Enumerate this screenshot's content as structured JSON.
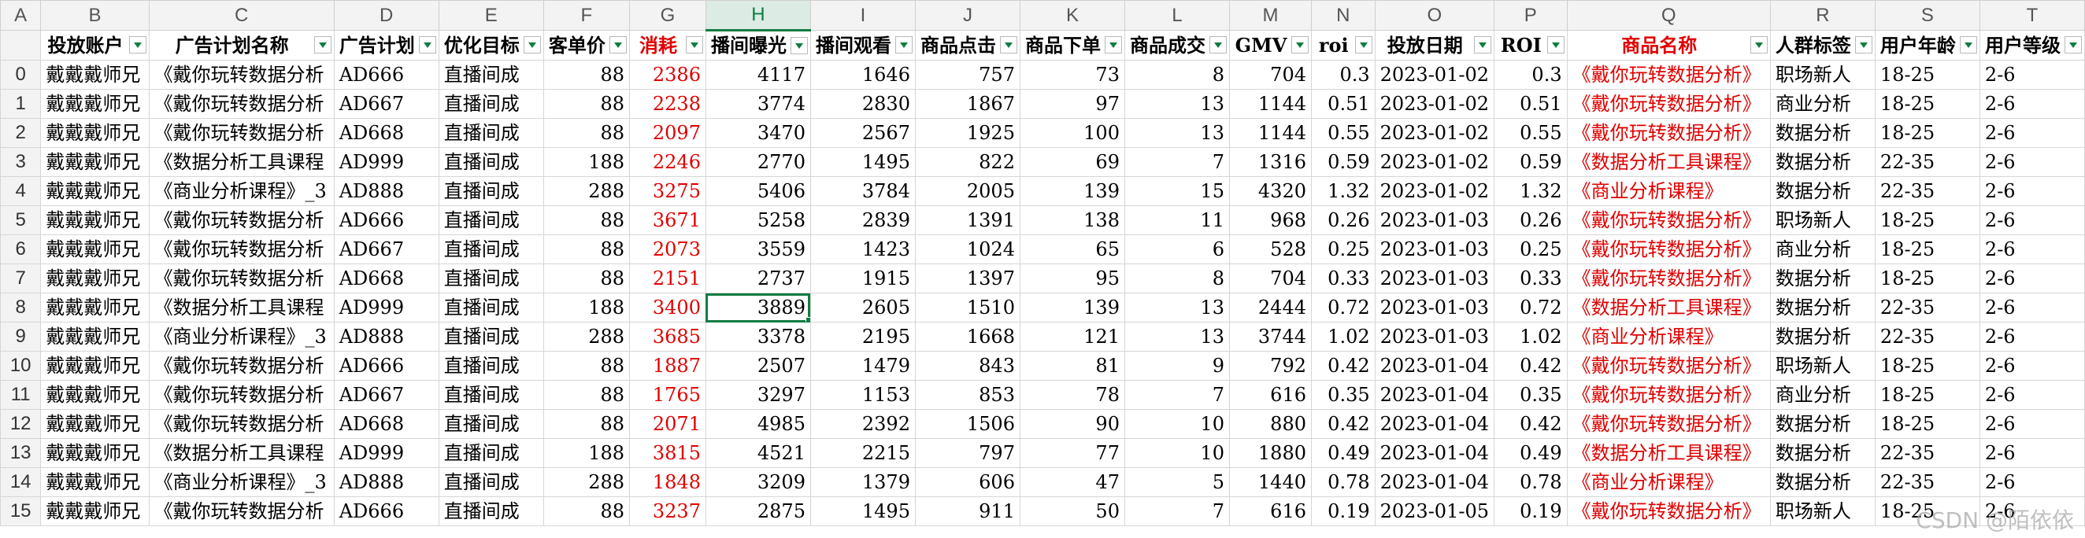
{
  "col_letters": [
    "A",
    "B",
    "C",
    "D",
    "E",
    "F",
    "G",
    "H",
    "I",
    "J",
    "K",
    "L",
    "M",
    "N",
    "O",
    "P",
    "Q",
    "R",
    "S",
    "T"
  ],
  "headers": [
    "投放账户",
    "广告计划名称",
    "广告计划",
    "优化目标",
    "客单价",
    "消耗",
    "播间曝光",
    "播间观看",
    "商品点击",
    "商品下单",
    "商品成交",
    "GMV",
    "roi",
    "投放日期",
    "ROI",
    "商品名称",
    "人群标签",
    "用户年龄",
    "用户等级"
  ],
  "rows": [
    {
      "idx": "0",
      "account": "戴戴戴师兄",
      "plan": "《戴你玩转数据分析",
      "pid": "AD666",
      "goal": "直播间成",
      "price": "88",
      "cost": "2386",
      "expo": "4117",
      "view": "1646",
      "click": "757",
      "order": "73",
      "deal": "8",
      "gmv": "704",
      "roi": "0.3",
      "date": "2023-01-02",
      "roi2": "0.3",
      "product": "《戴你玩转数据分析》",
      "tag": "职场新人",
      "age": "18-25",
      "level": "2-6"
    },
    {
      "idx": "1",
      "account": "戴戴戴师兄",
      "plan": "《戴你玩转数据分析",
      "pid": "AD667",
      "goal": "直播间成",
      "price": "88",
      "cost": "2238",
      "expo": "3774",
      "view": "2830",
      "click": "1867",
      "order": "97",
      "deal": "13",
      "gmv": "1144",
      "roi": "0.51",
      "date": "2023-01-02",
      "roi2": "0.51",
      "product": "《戴你玩转数据分析》",
      "tag": "商业分析",
      "age": "18-25",
      "level": "2-6"
    },
    {
      "idx": "2",
      "account": "戴戴戴师兄",
      "plan": "《戴你玩转数据分析",
      "pid": "AD668",
      "goal": "直播间成",
      "price": "88",
      "cost": "2097",
      "expo": "3470",
      "view": "2567",
      "click": "1925",
      "order": "100",
      "deal": "13",
      "gmv": "1144",
      "roi": "0.55",
      "date": "2023-01-02",
      "roi2": "0.55",
      "product": "《戴你玩转数据分析》",
      "tag": "数据分析",
      "age": "18-25",
      "level": "2-6"
    },
    {
      "idx": "3",
      "account": "戴戴戴师兄",
      "plan": "《数据分析工具课程",
      "pid": "AD999",
      "goal": "直播间成",
      "price": "188",
      "cost": "2246",
      "expo": "2770",
      "view": "1495",
      "click": "822",
      "order": "69",
      "deal": "7",
      "gmv": "1316",
      "roi": "0.59",
      "date": "2023-01-02",
      "roi2": "0.59",
      "product": "《数据分析工具课程》",
      "tag": "数据分析",
      "age": "22-35",
      "level": "2-6"
    },
    {
      "idx": "4",
      "account": "戴戴戴师兄",
      "plan": "《商业分析课程》_3",
      "pid": "AD888",
      "goal": "直播间成",
      "price": "288",
      "cost": "3275",
      "expo": "5406",
      "view": "3784",
      "click": "2005",
      "order": "139",
      "deal": "15",
      "gmv": "4320",
      "roi": "1.32",
      "date": "2023-01-02",
      "roi2": "1.32",
      "product": "《商业分析课程》",
      "tag": "数据分析",
      "age": "22-35",
      "level": "2-6"
    },
    {
      "idx": "5",
      "account": "戴戴戴师兄",
      "plan": "《戴你玩转数据分析",
      "pid": "AD666",
      "goal": "直播间成",
      "price": "88",
      "cost": "3671",
      "expo": "5258",
      "view": "2839",
      "click": "1391",
      "order": "138",
      "deal": "11",
      "gmv": "968",
      "roi": "0.26",
      "date": "2023-01-03",
      "roi2": "0.26",
      "product": "《戴你玩转数据分析》",
      "tag": "职场新人",
      "age": "18-25",
      "level": "2-6"
    },
    {
      "idx": "6",
      "account": "戴戴戴师兄",
      "plan": "《戴你玩转数据分析",
      "pid": "AD667",
      "goal": "直播间成",
      "price": "88",
      "cost": "2073",
      "expo": "3559",
      "view": "1423",
      "click": "1024",
      "order": "65",
      "deal": "6",
      "gmv": "528",
      "roi": "0.25",
      "date": "2023-01-03",
      "roi2": "0.25",
      "product": "《戴你玩转数据分析》",
      "tag": "商业分析",
      "age": "18-25",
      "level": "2-6"
    },
    {
      "idx": "7",
      "account": "戴戴戴师兄",
      "plan": "《戴你玩转数据分析",
      "pid": "AD668",
      "goal": "直播间成",
      "price": "88",
      "cost": "2151",
      "expo": "2737",
      "view": "1915",
      "click": "1397",
      "order": "95",
      "deal": "8",
      "gmv": "704",
      "roi": "0.33",
      "date": "2023-01-03",
      "roi2": "0.33",
      "product": "《戴你玩转数据分析》",
      "tag": "数据分析",
      "age": "18-25",
      "level": "2-6"
    },
    {
      "idx": "8",
      "account": "戴戴戴师兄",
      "plan": "《数据分析工具课程",
      "pid": "AD999",
      "goal": "直播间成",
      "price": "188",
      "cost": "3400",
      "expo": "3889",
      "view": "2605",
      "click": "1510",
      "order": "139",
      "deal": "13",
      "gmv": "2444",
      "roi": "0.72",
      "date": "2023-01-03",
      "roi2": "0.72",
      "product": "《数据分析工具课程》",
      "tag": "数据分析",
      "age": "22-35",
      "level": "2-6"
    },
    {
      "idx": "9",
      "account": "戴戴戴师兄",
      "plan": "《商业分析课程》_3",
      "pid": "AD888",
      "goal": "直播间成",
      "price": "288",
      "cost": "3685",
      "expo": "3378",
      "view": "2195",
      "click": "1668",
      "order": "121",
      "deal": "13",
      "gmv": "3744",
      "roi": "1.02",
      "date": "2023-01-03",
      "roi2": "1.02",
      "product": "《商业分析课程》",
      "tag": "数据分析",
      "age": "22-35",
      "level": "2-6"
    },
    {
      "idx": "10",
      "account": "戴戴戴师兄",
      "plan": "《戴你玩转数据分析",
      "pid": "AD666",
      "goal": "直播间成",
      "price": "88",
      "cost": "1887",
      "expo": "2507",
      "view": "1479",
      "click": "843",
      "order": "81",
      "deal": "9",
      "gmv": "792",
      "roi": "0.42",
      "date": "2023-01-04",
      "roi2": "0.42",
      "product": "《戴你玩转数据分析》",
      "tag": "职场新人",
      "age": "18-25",
      "level": "2-6"
    },
    {
      "idx": "11",
      "account": "戴戴戴师兄",
      "plan": "《戴你玩转数据分析",
      "pid": "AD667",
      "goal": "直播间成",
      "price": "88",
      "cost": "1765",
      "expo": "3297",
      "view": "1153",
      "click": "853",
      "order": "78",
      "deal": "7",
      "gmv": "616",
      "roi": "0.35",
      "date": "2023-01-04",
      "roi2": "0.35",
      "product": "《戴你玩转数据分析》",
      "tag": "商业分析",
      "age": "18-25",
      "level": "2-6"
    },
    {
      "idx": "12",
      "account": "戴戴戴师兄",
      "plan": "《戴你玩转数据分析",
      "pid": "AD668",
      "goal": "直播间成",
      "price": "88",
      "cost": "2071",
      "expo": "4985",
      "view": "2392",
      "click": "1506",
      "order": "90",
      "deal": "10",
      "gmv": "880",
      "roi": "0.42",
      "date": "2023-01-04",
      "roi2": "0.42",
      "product": "《戴你玩转数据分析》",
      "tag": "数据分析",
      "age": "18-25",
      "level": "2-6"
    },
    {
      "idx": "13",
      "account": "戴戴戴师兄",
      "plan": "《数据分析工具课程",
      "pid": "AD999",
      "goal": "直播间成",
      "price": "188",
      "cost": "3815",
      "expo": "4521",
      "view": "2215",
      "click": "797",
      "order": "77",
      "deal": "10",
      "gmv": "1880",
      "roi": "0.49",
      "date": "2023-01-04",
      "roi2": "0.49",
      "product": "《数据分析工具课程》",
      "tag": "数据分析",
      "age": "22-35",
      "level": "2-6"
    },
    {
      "idx": "14",
      "account": "戴戴戴师兄",
      "plan": "《商业分析课程》_3",
      "pid": "AD888",
      "goal": "直播间成",
      "price": "288",
      "cost": "1848",
      "expo": "3209",
      "view": "1379",
      "click": "606",
      "order": "47",
      "deal": "5",
      "gmv": "1440",
      "roi": "0.78",
      "date": "2023-01-04",
      "roi2": "0.78",
      "product": "《商业分析课程》",
      "tag": "数据分析",
      "age": "22-35",
      "level": "2-6"
    },
    {
      "idx": "15",
      "account": "戴戴戴师兄",
      "plan": "《戴你玩转数据分析",
      "pid": "AD666",
      "goal": "直播间成",
      "price": "88",
      "cost": "3237",
      "expo": "2875",
      "view": "1495",
      "click": "911",
      "order": "50",
      "deal": "7",
      "gmv": "616",
      "roi": "0.19",
      "date": "2023-01-05",
      "roi2": "0.19",
      "product": "《戴你玩转数据分析》",
      "tag": "职场新人",
      "age": "18-25",
      "level": "2-6"
    }
  ],
  "watermark": "CSDN @陌依依",
  "colors": {
    "accent": "#107c41",
    "red": "#e00000"
  }
}
